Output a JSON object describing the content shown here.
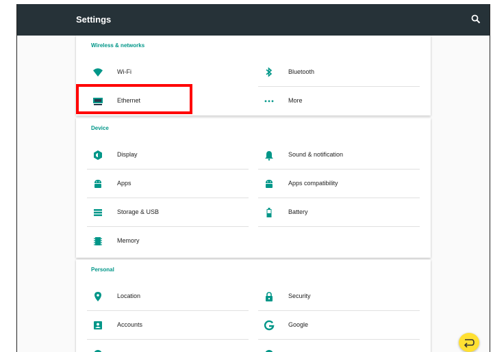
{
  "appbar": {
    "title": "Settings",
    "search_icon": "search-icon"
  },
  "sections": {
    "wireless": {
      "header": "Wireless & networks",
      "items": [
        {
          "label": "Wi-Fi",
          "icon": "wifi-icon"
        },
        {
          "label": "Bluetooth",
          "icon": "bluetooth-icon"
        },
        {
          "label": "Ethernet",
          "icon": "ethernet-icon"
        },
        {
          "label": "More",
          "icon": "more-icon"
        }
      ]
    },
    "device": {
      "header": "Device",
      "items": [
        {
          "label": "Display",
          "icon": "display-icon"
        },
        {
          "label": "Sound & notification",
          "icon": "bell-icon"
        },
        {
          "label": "Apps",
          "icon": "android-icon"
        },
        {
          "label": "Apps compatibility",
          "icon": "android-icon"
        },
        {
          "label": "Storage & USB",
          "icon": "storage-icon"
        },
        {
          "label": "Battery",
          "icon": "battery-icon"
        },
        {
          "label": "Memory",
          "icon": "memory-icon"
        }
      ]
    },
    "personal": {
      "header": "Personal",
      "items": [
        {
          "label": "Location",
          "icon": "location-icon"
        },
        {
          "label": "Security",
          "icon": "lock-icon"
        },
        {
          "label": "Accounts",
          "icon": "account-icon"
        },
        {
          "label": "Google",
          "icon": "google-icon"
        }
      ]
    }
  },
  "colors": {
    "accent": "#009688",
    "appbar": "#263238",
    "highlight": "#ff0000",
    "fab": "#ffe032"
  }
}
